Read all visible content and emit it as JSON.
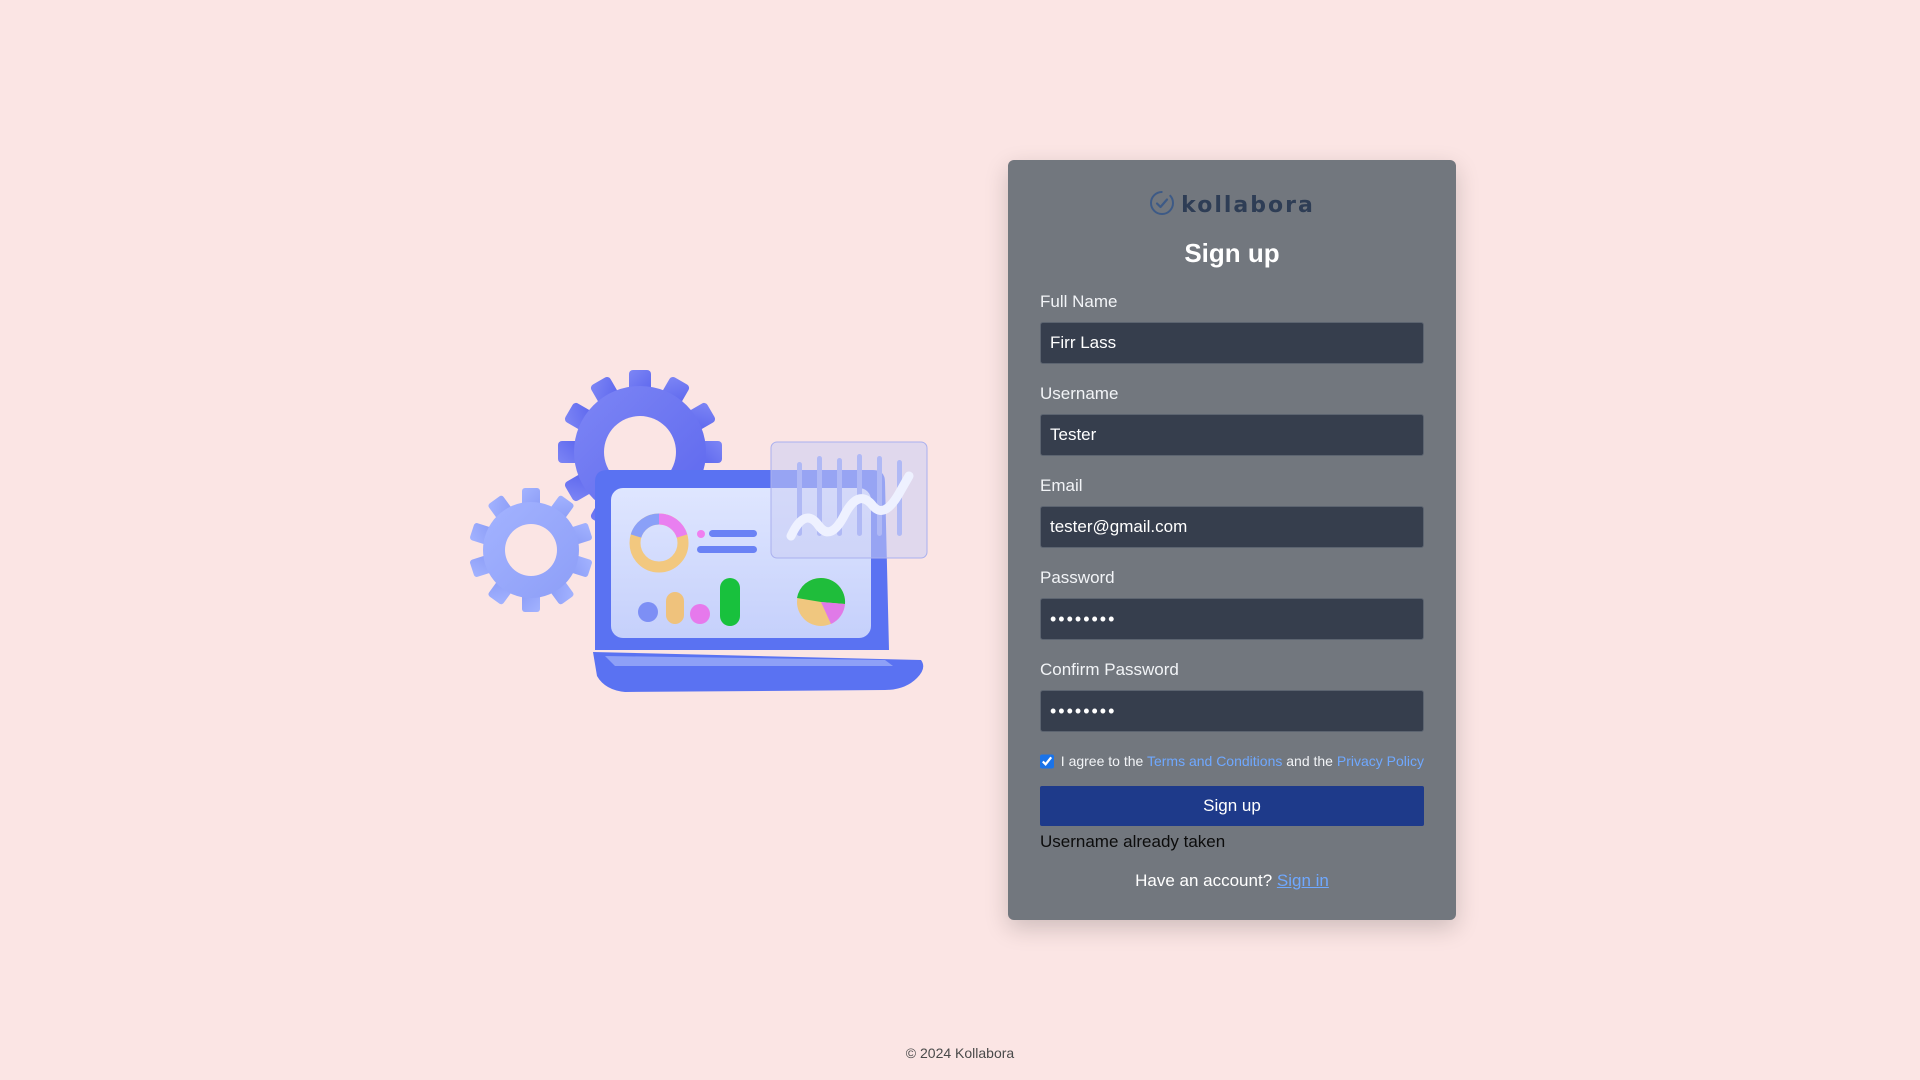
{
  "brand": {
    "logo_text": "kollabora",
    "logo_color": "#2e3d55",
    "logo_icon": "check-circle-icon"
  },
  "form": {
    "title": "Sign up",
    "full_name": {
      "label": "Full Name",
      "value": "Firr Lass"
    },
    "username": {
      "label": "Username",
      "value": "Tester"
    },
    "email": {
      "label": "Email",
      "value": "tester@gmail.com"
    },
    "password": {
      "label": "Password",
      "value": "••••••••"
    },
    "confirm_password": {
      "label": "Confirm Password",
      "value": "••••••••"
    },
    "agree": {
      "checked": true,
      "text_before": "I agree to the",
      "terms_link": "Terms and Conditions",
      "text_middle": "and the",
      "privacy_link": "Privacy Policy"
    },
    "submit_label": "Sign up",
    "error_message": "Username already taken",
    "have_account_text": "Have an account?",
    "signin_link": "Sign in"
  },
  "footer": {
    "text": "© 2024 Kollabora"
  },
  "colors": {
    "background": "#fbe5e4",
    "card": "#72777e",
    "input": "#363e4d",
    "button": "#1e3a8a",
    "link": "#6fa8ff"
  }
}
